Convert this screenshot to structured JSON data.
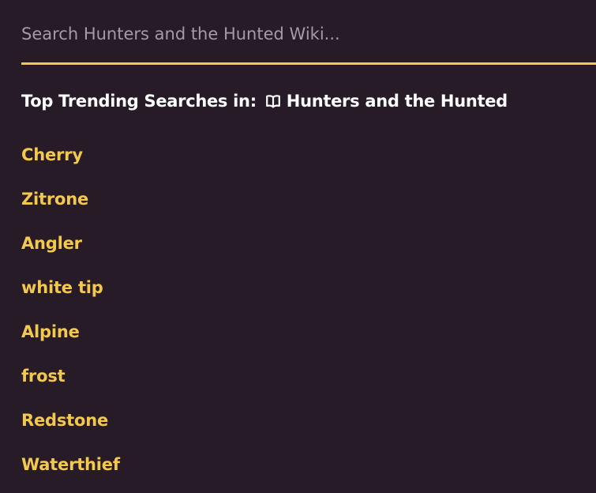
{
  "search": {
    "placeholder": "Search Hunters and the Hunted Wiki..."
  },
  "trending": {
    "prefix": "Top Trending Searches in:",
    "icon": "book-icon",
    "wiki_name": "Hunters and the Hunted",
    "items": [
      "Cherry",
      "Zitrone",
      "Angler",
      "white tip",
      "Alpine",
      "frost",
      "Redstone",
      "Waterthief"
    ]
  },
  "colors": {
    "background": "#271b27",
    "accent": "#f2c94c",
    "text": "#ffffff",
    "placeholder": "#a39ba3"
  }
}
